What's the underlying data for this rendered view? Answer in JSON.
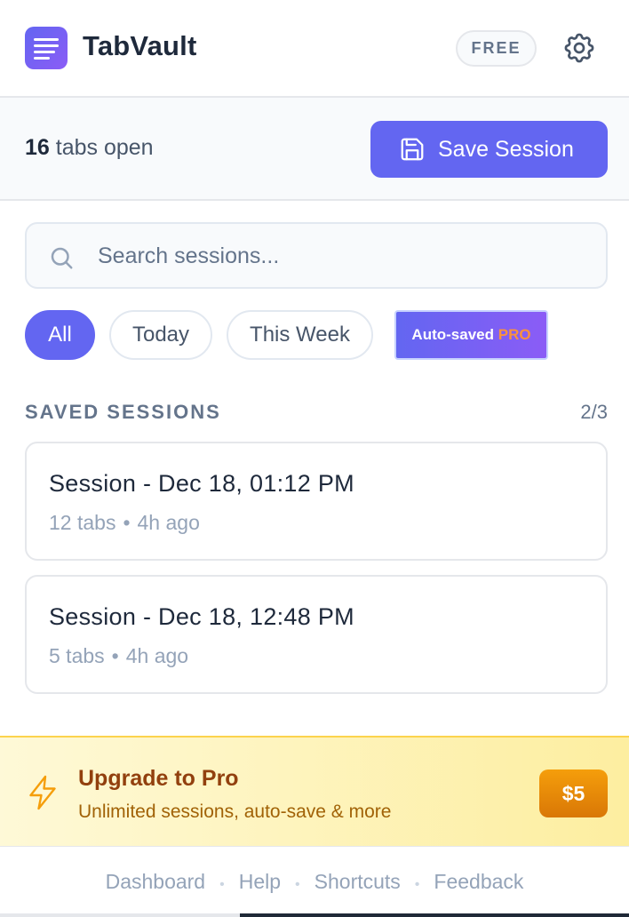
{
  "header": {
    "app_title": "TabVault",
    "plan_badge": "FREE",
    "icons": {
      "logo": "list-logo-icon",
      "settings": "gear-icon"
    }
  },
  "toolbar": {
    "tab_count": "16",
    "tab_count_suffix": " tabs open",
    "save_label": "Save Session",
    "save_icon": "floppy-disk-icon"
  },
  "search": {
    "placeholder": "Search sessions...",
    "value": ""
  },
  "filters": [
    {
      "label": "All",
      "active": true
    },
    {
      "label": "Today",
      "active": false
    },
    {
      "label": "This Week",
      "active": false
    },
    {
      "label": "Auto-saved",
      "badge": "PRO",
      "active": false
    }
  ],
  "sessions_section": {
    "title": "SAVED SESSIONS",
    "count": "2/3",
    "items": [
      {
        "title": "Session - Dec 18, 01:12 PM",
        "tabs": "12 tabs",
        "sep": "•",
        "age": "4h ago"
      },
      {
        "title": "Session - Dec 18, 12:48 PM",
        "tabs": "5 tabs",
        "sep": "•",
        "age": "4h ago"
      }
    ]
  },
  "upgrade": {
    "title": "Upgrade to Pro",
    "subtitle": "Unlimited sessions, auto-save & more",
    "price": "$5",
    "icon": "lightning-bolt-icon"
  },
  "footer": {
    "links": [
      "Dashboard",
      "Help",
      "Shortcuts",
      "Feedback"
    ],
    "separator": "•"
  },
  "colors": {
    "accent": "#6366f1",
    "accent_secondary": "#8b5cf6",
    "upgrade_bg": "#fdf1b6",
    "price_bg": "#e58f1c",
    "pro_text": "#fb923c"
  }
}
